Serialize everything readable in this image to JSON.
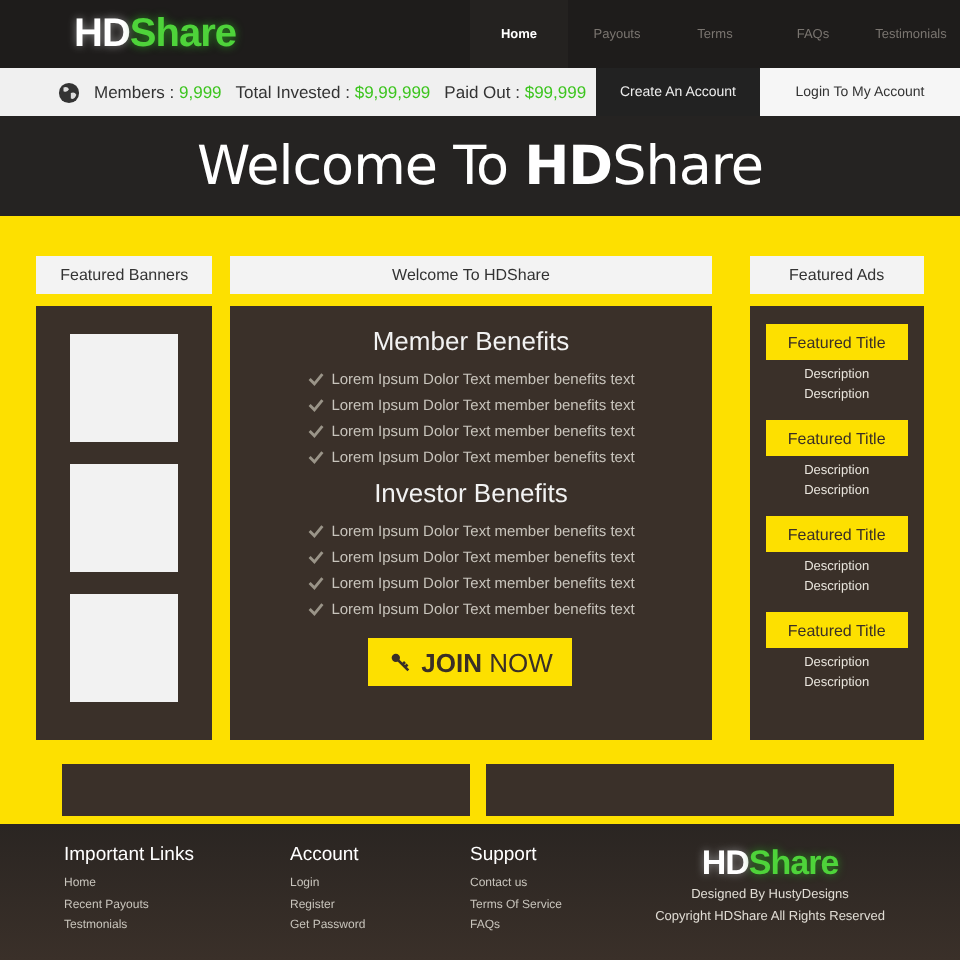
{
  "header": {
    "logo": {
      "main": "HD",
      "accent": "Share"
    },
    "nav": [
      {
        "label": "Home",
        "selected": true
      },
      {
        "label": "Payouts",
        "selected": false
      },
      {
        "label": "Terms",
        "selected": false
      },
      {
        "label": "FAQs",
        "selected": false
      },
      {
        "label": "Testimonials",
        "selected": false
      }
    ]
  },
  "stats": [
    {
      "label": "Members :",
      "value": "9,999"
    },
    {
      "label": "Total Invested :",
      "value": "$9,99,999"
    },
    {
      "label": "Paid Out :",
      "value": "$99,999"
    }
  ],
  "account_buttons": [
    {
      "label": "Create An Account",
      "kind": "dark"
    },
    {
      "label": "Login To My Account",
      "kind": "light"
    }
  ],
  "hero": {
    "title": "Welcome To **HD**Share"
  },
  "banners": {
    "heading": "Featured Banners",
    "slots": [
      {
        "kind": "blank"
      },
      {
        "kind": "blank"
      },
      {
        "kind": "blank"
      }
    ]
  },
  "main": {
    "heading": "Welcome To HDShare",
    "sections": [
      {
        "title": "Member Benefits",
        "items": [
          "Lorem Ipsum Dolor Text member benefits text",
          "Lorem Ipsum Dolor Text member benefits text",
          "Lorem Ipsum Dolor Text member benefits text",
          "Lorem Ipsum Dolor Text member benefits text"
        ]
      },
      {
        "title": "Investor Benefits",
        "items": [
          "Lorem Ipsum Dolor Text member benefits text",
          "Lorem Ipsum Dolor Text member benefits text",
          "Lorem Ipsum Dolor Text member benefits text",
          "Lorem Ipsum Dolor Text member benefits text"
        ]
      }
    ],
    "join_button": {
      "label": "**JOIN** NOW"
    }
  },
  "ads": {
    "heading": "Featured Ads",
    "items": [
      {
        "title": "Featured Title",
        "lines": [
          "Description",
          "Description"
        ]
      },
      {
        "title": "Featured Title",
        "lines": [
          "Description",
          "Description"
        ]
      },
      {
        "title": "Featured Title",
        "lines": [
          "Description",
          "Description"
        ]
      },
      {
        "title": "Featured Title",
        "lines": [
          "Description",
          "Description"
        ]
      }
    ]
  },
  "footer": {
    "columns": [
      {
        "title": "Important Links",
        "links": [
          "Home",
          "Recent Payouts",
          "Testmonials"
        ]
      },
      {
        "title": "Account",
        "links": [
          "Login",
          "Register",
          "Get Password"
        ]
      },
      {
        "title": "Support",
        "links": [
          "Contact us",
          "Terms Of Service",
          "FAQs"
        ]
      }
    ],
    "logo": {
      "main": "HD",
      "accent": "Share"
    },
    "credits": [
      "Designed By HustyDesigns",
      "Copyright HDShare All Rights Reserved"
    ]
  }
}
